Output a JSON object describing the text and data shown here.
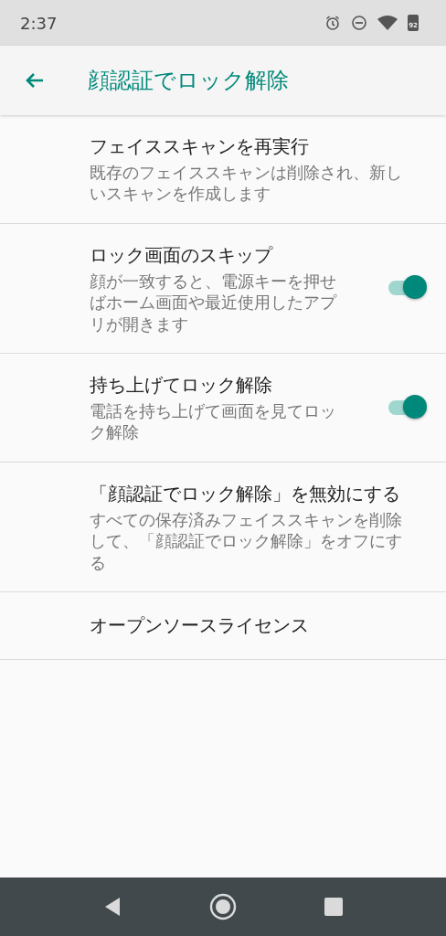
{
  "status_bar": {
    "time": "2:37",
    "battery": "92"
  },
  "app_bar": {
    "title": "顔認証でロック解除"
  },
  "items": [
    {
      "kind": "action",
      "title": "フェイススキャンを再実行",
      "summary": "既存のフェイススキャンは削除され、新しいスキャンを作成します"
    },
    {
      "kind": "switch",
      "title": "ロック画面のスキップ",
      "summary": "顔が一致すると、電源キーを押せばホーム画面や最近使用したアプリが開きます",
      "on": true
    },
    {
      "kind": "switch",
      "title": "持ち上げてロック解除",
      "summary": "電話を持ち上げて画面を見てロック解除",
      "on": true
    },
    {
      "kind": "action",
      "title": "「顔認証でロック解除」を無効にする",
      "summary": "すべての保存済みフェイススキャンを削除して、「顔認証でロック解除」をオフにする"
    },
    {
      "kind": "action",
      "title": "オープンソースライセンス"
    }
  ]
}
